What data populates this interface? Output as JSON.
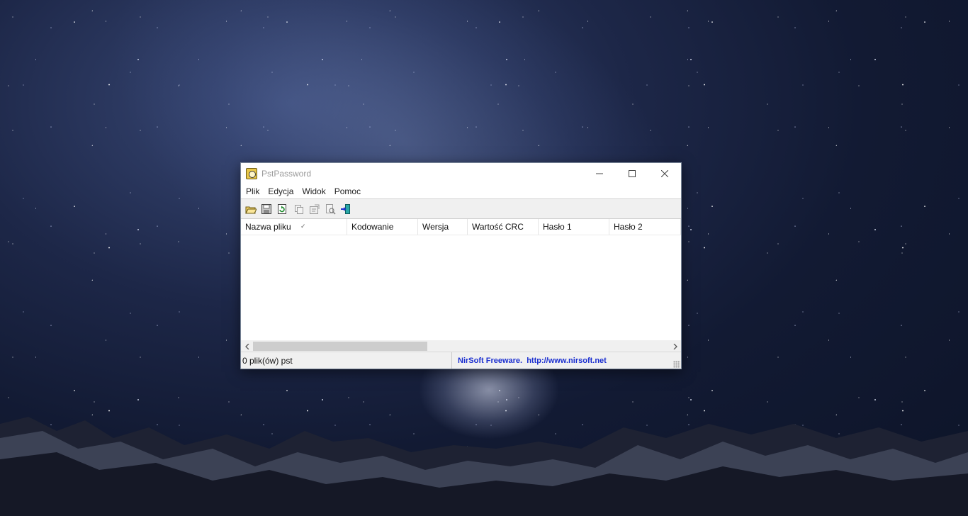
{
  "window": {
    "title": "PstPassword"
  },
  "menu": {
    "items": [
      "Plik",
      "Edycja",
      "Widok",
      "Pomoc"
    ]
  },
  "toolbar": {
    "icons": [
      "open-folder-icon",
      "save-icon",
      "refresh-icon",
      "copy-icon",
      "properties-icon",
      "find-icon",
      "exit-icon"
    ]
  },
  "table": {
    "columns": [
      "Nazwa pliku",
      "Kodowanie",
      "Wersja",
      "Wartość CRC",
      "Hasło 1",
      "Hasło 2"
    ],
    "rows": []
  },
  "status": {
    "left": "0 plik(ów) pst",
    "right": "NirSoft Freeware.  http://www.nirsoft.net"
  },
  "colors": {
    "link": "#1b2fd0",
    "title_text": "#9a9a9a"
  }
}
